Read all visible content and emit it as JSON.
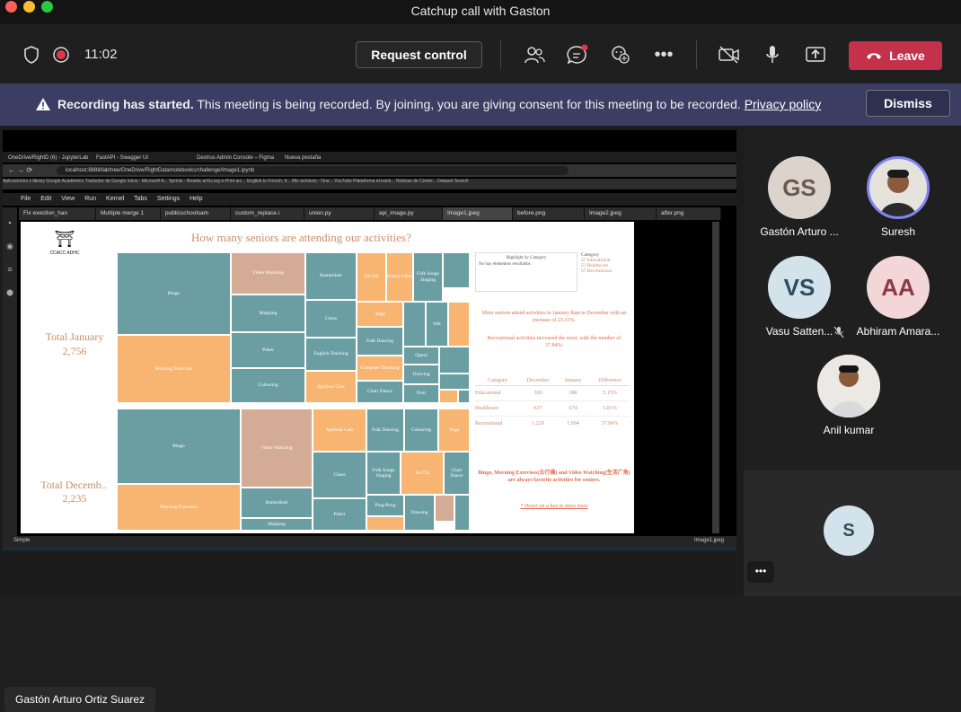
{
  "window": {
    "title": "Catchup call with Gaston"
  },
  "toolbar": {
    "time": "11:02",
    "request_control": "Request control",
    "leave": "Leave"
  },
  "banner": {
    "bold": "Recording has started.",
    "text": " This meeting is being recorded. By joining, you are giving consent for this meeting to be recorded. ",
    "link": "Privacy policy",
    "dismiss": "Dismiss"
  },
  "presenter_name": "Gastón Arturo Ortiz Suarez",
  "participants": [
    {
      "initials": "GS",
      "name": "Gastón Arturo ..."
    },
    {
      "initials": "",
      "name": "Suresh"
    },
    {
      "initials": "VS",
      "name": "Vasu Satten..."
    },
    {
      "initials": "AA",
      "name": "Abhiram Amara..."
    },
    {
      "initials": "",
      "name": "Anil kumar"
    },
    {
      "initials": "S",
      "name": ""
    }
  ],
  "shared": {
    "browser_tabs": [
      "OneDrive/RightD (6) - JupyterLab",
      "FastAPI - Swagger UI",
      "Dextrus Admin Console – Figma",
      "Nueva pestaña"
    ],
    "url": "localhost:8888/lab/tree/OneDrive/RightData/notebooks/challenge/Image1.ipynb",
    "bookmarks": "Aplicaciones   z library   Google Académico   Traductor de Google   Inicio - Microsoft A...   Sprints - Boards   arXiv.org e-Print arc...   English to French, It...   Mis archivos - One...   YouTube   Plataforma eLearni...   Noticias de Contei...   Dataset Search",
    "menu": [
      "File",
      "Edit",
      "View",
      "Run",
      "Kernel",
      "Tabs",
      "Settings",
      "Help"
    ],
    "file_tabs": [
      "Fix exection_han",
      "Multiple merge 1",
      "publicschoolsam",
      "custom_replace.i",
      "union.py",
      "api_image.py",
      "Image1.jpeg",
      "before.png",
      "Image2.jpeg",
      "after.png"
    ],
    "status_left": "Simple",
    "status_right": "Image1.jpeg",
    "logo": "CCACC ADHC",
    "dashboard_title": "How many seniors are attending our activities?",
    "total_jan_label": "Total January",
    "total_jan_value": "2,756",
    "total_dec_label": "Total Decemb..",
    "total_dec_value": "2,235",
    "highlight_label": "Highlight by Category",
    "highlight_empty": "No hay elementos resultados",
    "legend_title": "Category",
    "legend": [
      "Educational",
      "Healthcare",
      "Recreational"
    ],
    "insight1": "More seniors attend activities in January than in December with an increase of 23.31%.",
    "insight2": "Recreational activities increased the most, with the number of 37.84%.",
    "insight3": "Bingo, Morning Exercises(五行操) and Video Watching(生活广角) are always favorite activities for seniors.",
    "hover_hint": "* Hover on a box to show more",
    "table": {
      "headers": [
        "Category",
        "December",
        "January",
        "Difference"
      ],
      "rows": [
        [
          "Educational",
          "369",
          "388",
          "5.15%"
        ],
        [
          "Healthcare",
          "637",
          "674",
          "5.81%"
        ],
        [
          "Recreational",
          "1,229",
          "1,694",
          "37.84%"
        ]
      ]
    },
    "jan_cells": [
      "Bingo",
      "Video Watching",
      "Rummikub",
      "Tai Chi",
      "Poetry Class",
      "Folk Songs Singing",
      "Mahjong",
      "Chess",
      "Yoga",
      "Silk",
      "Poker",
      "Folk Dancing",
      "English Teaching",
      "Computer Teaching",
      "Opera",
      "Morning Exercises",
      "Colouring",
      "Spiritual Care",
      "Chair Dance",
      "Drawing",
      "Pool"
    ],
    "dec_cells": [
      "Bingo",
      "Video Watching",
      "Spiritual Care",
      "Folk Dancing",
      "Colouring",
      "Yoga",
      "Chess",
      "Folk Songs Singing",
      "Tai Chi",
      "Chair Dance",
      "Rummikub",
      "Poker",
      "Ping-Pong",
      "Drawing",
      "Morning Exercises",
      "Mahjong"
    ],
    "colors": {
      "recreational": "#6a9ea2",
      "healthcare": "#d4ab95",
      "educational": "#f8b571"
    }
  }
}
